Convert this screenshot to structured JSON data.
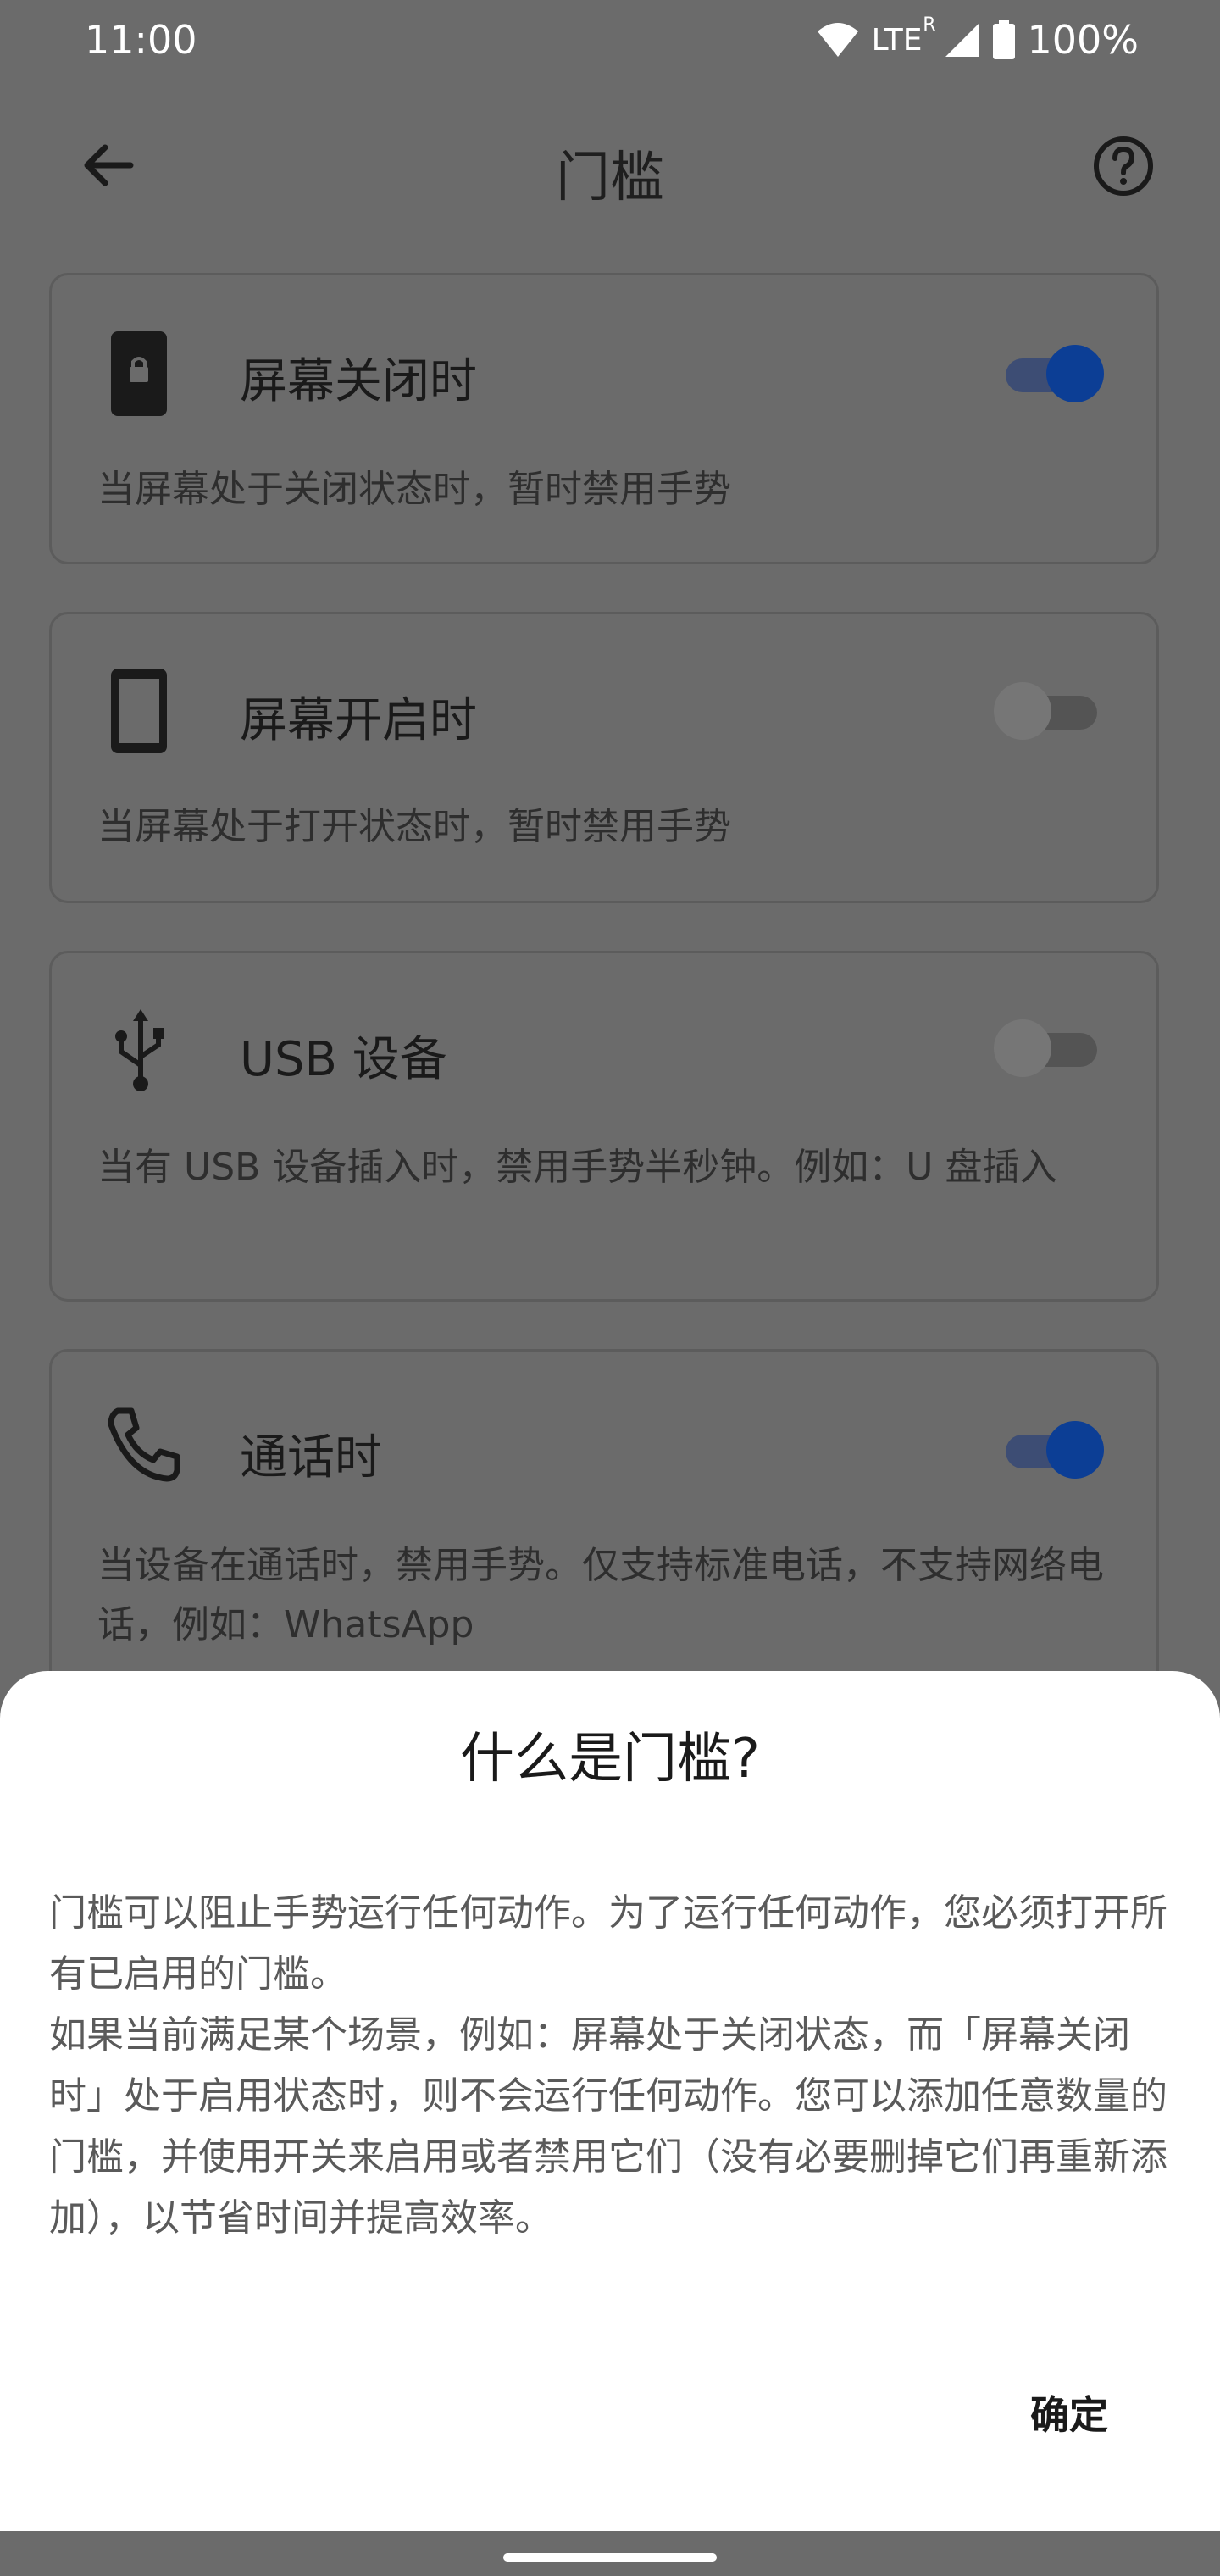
{
  "status_bar": {
    "time": "11:00",
    "network": "LTE",
    "roaming": "R",
    "battery": "100%"
  },
  "app_bar": {
    "title": "门槛",
    "back_icon": "arrow-back-icon",
    "help_icon": "help-circle-icon"
  },
  "cards": [
    {
      "title": "屏幕关闭时",
      "description": "当屏幕处于关闭状态时，暂时禁用手势",
      "icon": "phone-lock-icon",
      "enabled": true
    },
    {
      "title": "屏幕开启时",
      "description": "当屏幕处于打开状态时，暂时禁用手势",
      "icon": "smartphone-icon",
      "enabled": false
    },
    {
      "title": "USB 设备",
      "description": "当有 USB 设备插入时，禁用手势半秒钟。例如：U 盘插入",
      "icon": "usb-icon",
      "enabled": false
    },
    {
      "title": "通话时",
      "description": "当设备在通话时，禁用手势。仅支持标准电话，不支持网络电话，例如：WhatsApp",
      "icon": "phone-call-icon",
      "enabled": true
    }
  ],
  "dialog": {
    "title": "什么是门槛?",
    "paragraph1": "门槛可以阻止手势运行任何动作。为了运行任何动作，您必须打开所有已启用的门槛。",
    "paragraph2": "如果当前满足某个场景，例如：屏幕处于关闭状态，而「屏幕关闭时」处于启用状态时，则不会运行任何动作。您可以添加任意数量的门槛，并使用开关来启用或者禁用它们（没有必要删掉它们再重新添加），以节省时间并提高效率。",
    "confirm_label": "确定"
  },
  "colors": {
    "scrim_background": "#6b6b6b",
    "toggle_on": "#0c3e95",
    "toggle_off": "#767676",
    "sheet_background": "#ffffff"
  }
}
